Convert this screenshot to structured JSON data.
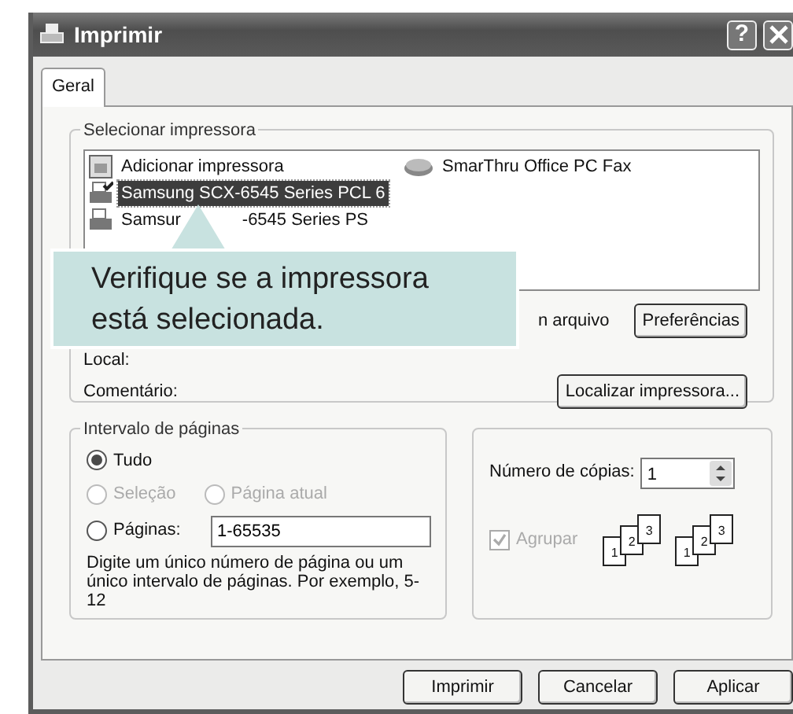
{
  "window": {
    "title": "Imprimir"
  },
  "title_buttons": [
    {
      "kind": "help",
      "label": "?"
    },
    {
      "kind": "close"
    }
  ],
  "tabs": [
    {
      "label": "Geral",
      "selected": true
    }
  ],
  "printer_group": {
    "title": "Selecionar impressora",
    "printers": [
      {
        "kind": "add",
        "label": "Adicionar impressora",
        "selected": false
      },
      {
        "kind": "printer",
        "label": "Samsung SCX-6545 Series PCL 6",
        "selected": true,
        "default": true
      },
      {
        "kind": "printer",
        "label": "Samsur",
        "label_2": "-6545 Series PS",
        "selected": false
      },
      {
        "kind": "fax",
        "label": "SmarThru Office PC Fax",
        "selected": false
      }
    ],
    "print_to_file_fragment": "n arquivo",
    "preferences_button": {
      "label": "Preferências"
    },
    "location_label": "Local:",
    "comment_label": "Comentário:",
    "find_button": {
      "label": "Localizar impressora..."
    }
  },
  "page_range": {
    "title": "Intervalo de páginas",
    "options": [
      {
        "label": "Tudo",
        "selected": true,
        "disabled": false
      },
      {
        "label": "Seleção",
        "selected": false,
        "disabled": true
      },
      {
        "label": "Página atual",
        "selected": false,
        "disabled": true
      },
      {
        "label": "Páginas:",
        "selected": false,
        "disabled": false
      }
    ],
    "pages_value": "1-65535",
    "hint": "Digite um único número de página ou um único intervalo de páginas. Por exemplo, 5-12"
  },
  "copies": {
    "label": "Número de cópias:",
    "value": "1",
    "collate": {
      "label": "Agrupar",
      "checked": true,
      "disabled": true
    },
    "collate_drawings": [
      {
        "pages": [
          "1",
          "2",
          "3"
        ]
      },
      {
        "pages": [
          "1",
          "2",
          "3"
        ]
      }
    ]
  },
  "buttons": [
    {
      "label": "Imprimir"
    },
    {
      "label": "Cancelar"
    },
    {
      "label": "Aplicar"
    }
  ],
  "callout": {
    "text": "Verifique se a impressora está selecionada."
  }
}
